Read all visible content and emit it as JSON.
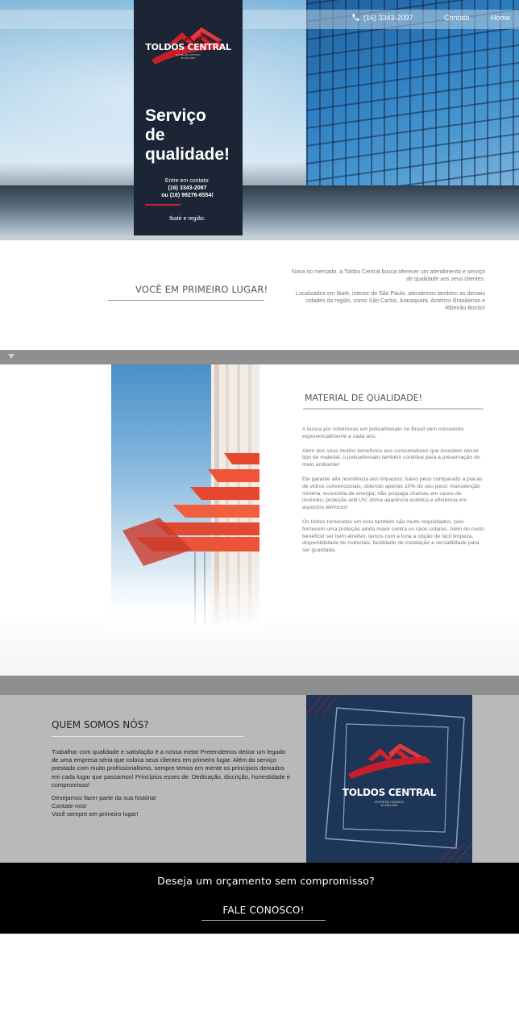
{
  "header": {
    "phone": "(16) 3343-2097",
    "nav": {
      "contato": "Contato",
      "home": "Home"
    }
  },
  "hero": {
    "brand": "TOLDOS CENTRAL",
    "brand_sub_1": "ENTRE EM CONTATO",
    "brand_sub_2": "16 3343-2097",
    "title_1": "Serviço",
    "title_2": "de",
    "title_3": "qualidade!",
    "contact_label": "Entre em contato:",
    "contact_phone_1": "(16) 3343-2097",
    "contact_phone_2": "ou (16) 99276-6554!",
    "region": "Ibaté e região."
  },
  "about_intro": {
    "title": "VOCÊ EM PRIMEIRO LUGAR!",
    "paragraph_1": "Nova no mercado, a Toldos Central busca oferecer um atendimento e serviço de qualidade aos seus clientes.",
    "paragraph_2": "Localizados em Ibaté, interior de São Paulo, atendemos também as demais cidades da região, como São Carlos, Araraquara, Américo Brasiliense e Ribeirão Bonito!"
  },
  "material": {
    "title": "MATERIAL DE QUALIDADE!",
    "paragraphs": [
      "A busca por coberturas em policarbonato no Brasil vem crescendo exponencialmente a cada ano.",
      "Além dos seus muitos benefícios aos consumidores que investem nesse tipo de material, o policarbonato também contribui para a preservação do meio ambiente!",
      "Ele garante alta resistência aos impactos; baixo peso comparado a placas de vidros convencionais, obtendo apenas 10% do seu peso; manutenção mínima; economia de energia; não propaga chamas em casos de incêndio; proteção anti UV; ótima aparência estética e eficiência em aspectos térmicos!",
      "Os toldos fornecidos em lona também são muito requisitados, pois fornecem uma proteção ainda maior contra os raios solares. Além do custo benefício ser bem atrativo, temos com a lona a opção de fácil limpeza, disponibilidade de materiais, facilidade de instalação e versatilidade para ser guardada."
    ]
  },
  "quem_somos": {
    "title": "QUEM SOMOS NÓS?",
    "paragraph_1": "Trabalhar com qualidade e satisfação é a nossa meta! Pretendemos deixar um legado de uma empresa séria que coloca seus clientes em primeiro lugar. Além do serviço prestado com muito profissionalismo, sempre temos em mente os princípios deixados em cada lugar que passamos! Princípios esses de: Dedicação, discrição, honestidade e compromisso!",
    "paragraph_2_line_1": "Desejamos fazer parte da sua história!",
    "paragraph_2_line_2": "Contate-nos!",
    "paragraph_2_line_3": "Você sempre em primeiro lugar!",
    "brand": "TOLDOS CENTRAL",
    "brand_sub_1": "ENTRE EM CONTATO",
    "brand_sub_2": "16 3343-2097"
  },
  "cta": {
    "text": "Deseja um orçamento sem compromisso?",
    "button": "FALE CONOSCO!"
  },
  "colors": {
    "panel_dark": "#1b2535",
    "accent_red": "#d0232a",
    "navy": "#1d3557",
    "grey_band": "#8f8f8f",
    "about_grey": "#b9b9b9"
  }
}
